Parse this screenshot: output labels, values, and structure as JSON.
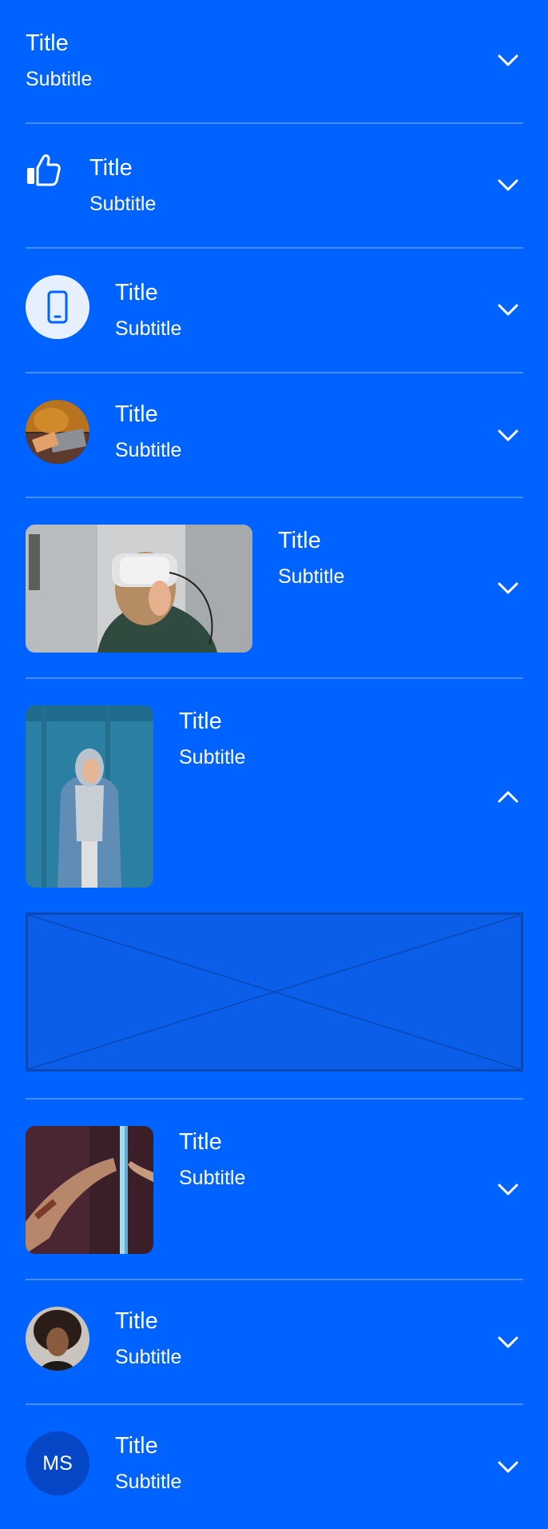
{
  "colors": {
    "background": "#0062ff",
    "divider": "rgba(255,255,255,0.28)",
    "icon_circle_bg": "#e6f0ff",
    "icon_circle_fg": "#0062ff",
    "initials_avatar_bg": "#0547c7",
    "placeholder_border": "#0a47b8"
  },
  "items": [
    {
      "title": "Title",
      "subtitle": "Subtitle",
      "leading": "none",
      "expanded": false,
      "chevron": "chevron-down-icon"
    },
    {
      "title": "Title",
      "subtitle": "Subtitle",
      "leading": "thumbs-up-icon",
      "expanded": false,
      "chevron": "chevron-down-icon"
    },
    {
      "title": "Title",
      "subtitle": "Subtitle",
      "leading": "smartphone-icon",
      "expanded": false,
      "chevron": "chevron-down-icon"
    },
    {
      "title": "Title",
      "subtitle": "Subtitle",
      "leading": "small-photo",
      "expanded": false,
      "chevron": "chevron-down-icon"
    },
    {
      "title": "Title",
      "subtitle": "Subtitle",
      "leading": "wide-photo",
      "expanded": false,
      "chevron": "chevron-down-icon"
    },
    {
      "title": "Title",
      "subtitle": "Subtitle",
      "leading": "tall-photo",
      "expanded": true,
      "chevron": "chevron-up-icon"
    },
    {
      "title": "Title",
      "subtitle": "Subtitle",
      "leading": "square-photo",
      "expanded": false,
      "chevron": "chevron-down-icon"
    },
    {
      "title": "Title",
      "subtitle": "Subtitle",
      "leading": "round-photo",
      "expanded": false,
      "chevron": "chevron-down-icon"
    },
    {
      "title": "Title",
      "subtitle": "Subtitle",
      "leading": "initials-avatar",
      "initials": "MS",
      "expanded": false,
      "chevron": "chevron-down-icon"
    }
  ]
}
